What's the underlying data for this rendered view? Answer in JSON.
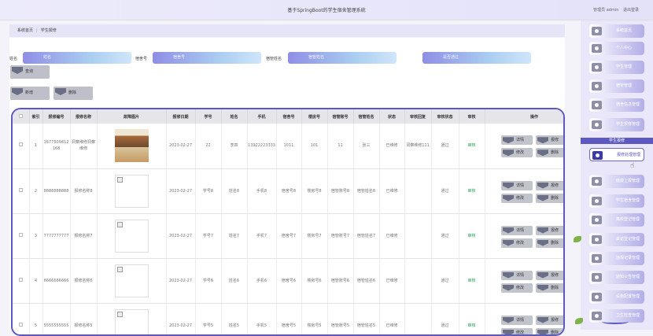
{
  "header": {
    "title": "基于SpringBoot的学生宿舍管理系统",
    "user_role": "管理员 admin",
    "logout": "退出登录"
  },
  "breadcrumb": {
    "home": "系统首页",
    "separator": "|",
    "current": "学生报修"
  },
  "search": {
    "fields": [
      {
        "label": "姓名",
        "placeholder": "姓名"
      },
      {
        "label": "宿舍号",
        "placeholder": "宿舍号"
      },
      {
        "label": "宿管姓名",
        "placeholder": "宿管姓名"
      },
      {
        "label": "",
        "placeholder": "是否通过"
      }
    ],
    "query_button": "查询"
  },
  "actions": {
    "add": "新增",
    "delete": "删除"
  },
  "table": {
    "headers": [
      "",
      "索引",
      "报修编号",
      "报修名称",
      "故障图片",
      "报修日期",
      "学号",
      "姓名",
      "手机",
      "宿舍号",
      "楼房号",
      "宿管账号",
      "宿管姓名",
      "状态",
      "审核回复",
      "审核状态",
      "审核",
      "操作"
    ],
    "rows": [
      {
        "index": "1",
        "code": "1677509812168",
        "name": "洞察维修洞察维修",
        "date": "2023-02-27",
        "sno": "22",
        "sname": "李四",
        "phone": "13922223333",
        "room": "1011",
        "building": "101",
        "acct": "11",
        "mname": "张三",
        "status": "已维修",
        "reply": "洞察维修111",
        "pass": "通过",
        "audit": "审核",
        "photo": true
      },
      {
        "index": "2",
        "code": "8888888888",
        "name": "报修名称8",
        "date": "2023-02-27",
        "sno": "学号8",
        "sname": "姓名8",
        "phone": "手机8",
        "room": "宿舍号8",
        "building": "楼房号8",
        "acct": "宿管账号8",
        "mname": "宿管姓名8",
        "status": "已维修",
        "reply": "",
        "pass": "通过",
        "audit": "审核",
        "photo": false
      },
      {
        "index": "3",
        "code": "7777777777",
        "name": "报修名称7",
        "date": "2023-02-27",
        "sno": "学号7",
        "sname": "姓名7",
        "phone": "手机7",
        "room": "宿舍号7",
        "building": "楼房号7",
        "acct": "宿管账号7",
        "mname": "宿管姓名7",
        "status": "已维修",
        "reply": "",
        "pass": "通过",
        "audit": "审核",
        "photo": false
      },
      {
        "index": "4",
        "code": "6666666666",
        "name": "报修名称6",
        "date": "2023-02-27",
        "sno": "学号6",
        "sname": "姓名6",
        "phone": "手机6",
        "room": "宿舍号6",
        "building": "楼房号6",
        "acct": "宿管账号6",
        "mname": "宿管姓名6",
        "status": "已维修",
        "reply": "",
        "pass": "通过",
        "audit": "审核",
        "photo": false
      },
      {
        "index": "5",
        "code": "5555555555",
        "name": "报修名称5",
        "date": "2023-02-27",
        "sno": "学号5",
        "sname": "姓名5",
        "phone": "手机5",
        "room": "宿舍号5",
        "building": "楼房号5",
        "acct": "宿管账号5",
        "mname": "宿管姓名5",
        "status": "已维修",
        "reply": "",
        "pass": "通过",
        "audit": "审核",
        "photo": false
      }
    ],
    "row_ops": {
      "detail": "详情",
      "edit": "修改",
      "repair": "报修",
      "remove": "删除"
    }
  },
  "sidebar": {
    "items": [
      "系统首页",
      "个人中心",
      "学生管理",
      "宿管管理",
      "宿舍信息管理",
      "学生报修管理",
      "学生报修",
      "报修处理管理",
      "健康上报管理",
      "学生宿舍管理",
      "离校登记管理",
      "来访登记管理",
      "违规记录管理",
      "通知公告管理",
      "设施配置管理",
      "卫生检查管理"
    ],
    "group": "学生报修",
    "active": "报修处理管理"
  }
}
